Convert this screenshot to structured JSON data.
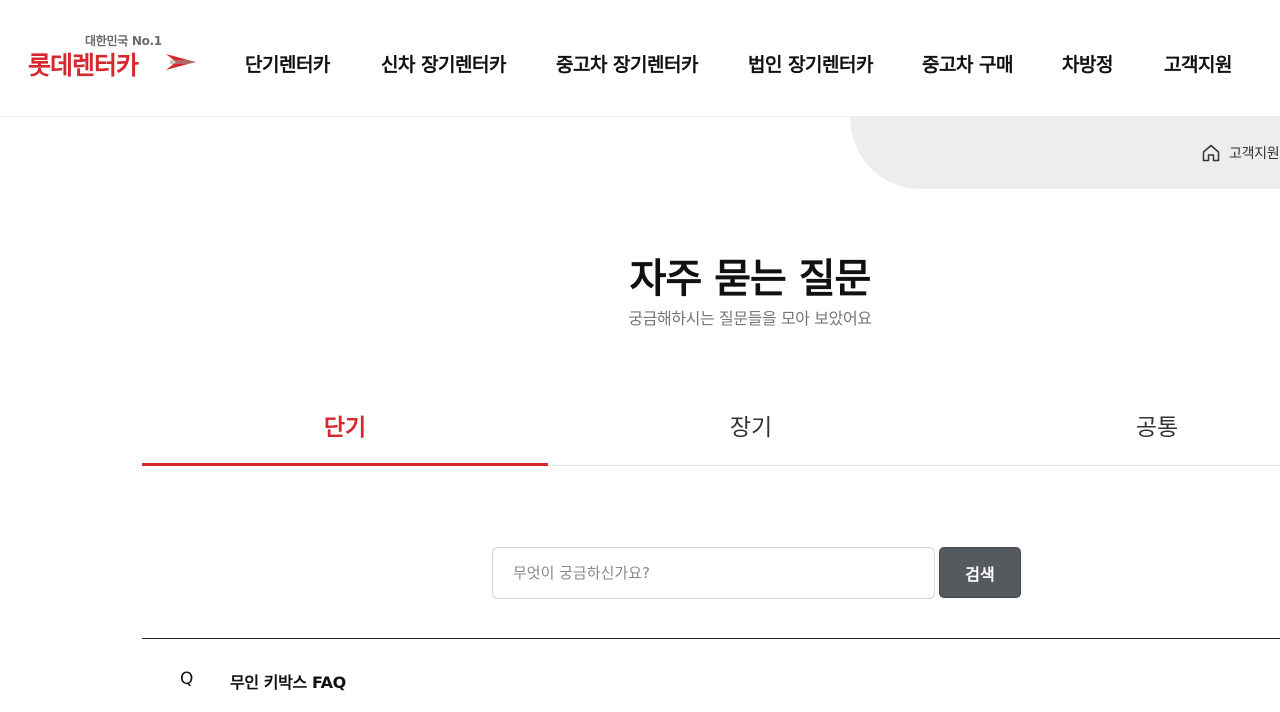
{
  "header": {
    "logo": {
      "tagline": "대한민국 No.1",
      "name": "롯데렌터카"
    },
    "nav": [
      "단기렌터카",
      "신차 장기렌터카",
      "중고차 장기렌터카",
      "법인 장기렌터카",
      "중고차 구매",
      "차방정",
      "고객지원"
    ]
  },
  "breadcrumb": {
    "current": "고객지원"
  },
  "page": {
    "title": "자주 묻는 질문",
    "subtitle": "궁금해하시는 질문들을 모아 보았어요"
  },
  "tabs": [
    {
      "label": "단기",
      "active": true
    },
    {
      "label": "장기",
      "active": false
    },
    {
      "label": "공통",
      "active": false
    }
  ],
  "search": {
    "placeholder": "무엇이 궁금하신가요?",
    "value": "",
    "button_label": "검색"
  },
  "faq": {
    "items": [
      {
        "marker": "Q",
        "title": "무인 키박스 FAQ"
      }
    ]
  },
  "colors": {
    "brand_red": "#d7282f",
    "search_button": "#555a5f"
  }
}
